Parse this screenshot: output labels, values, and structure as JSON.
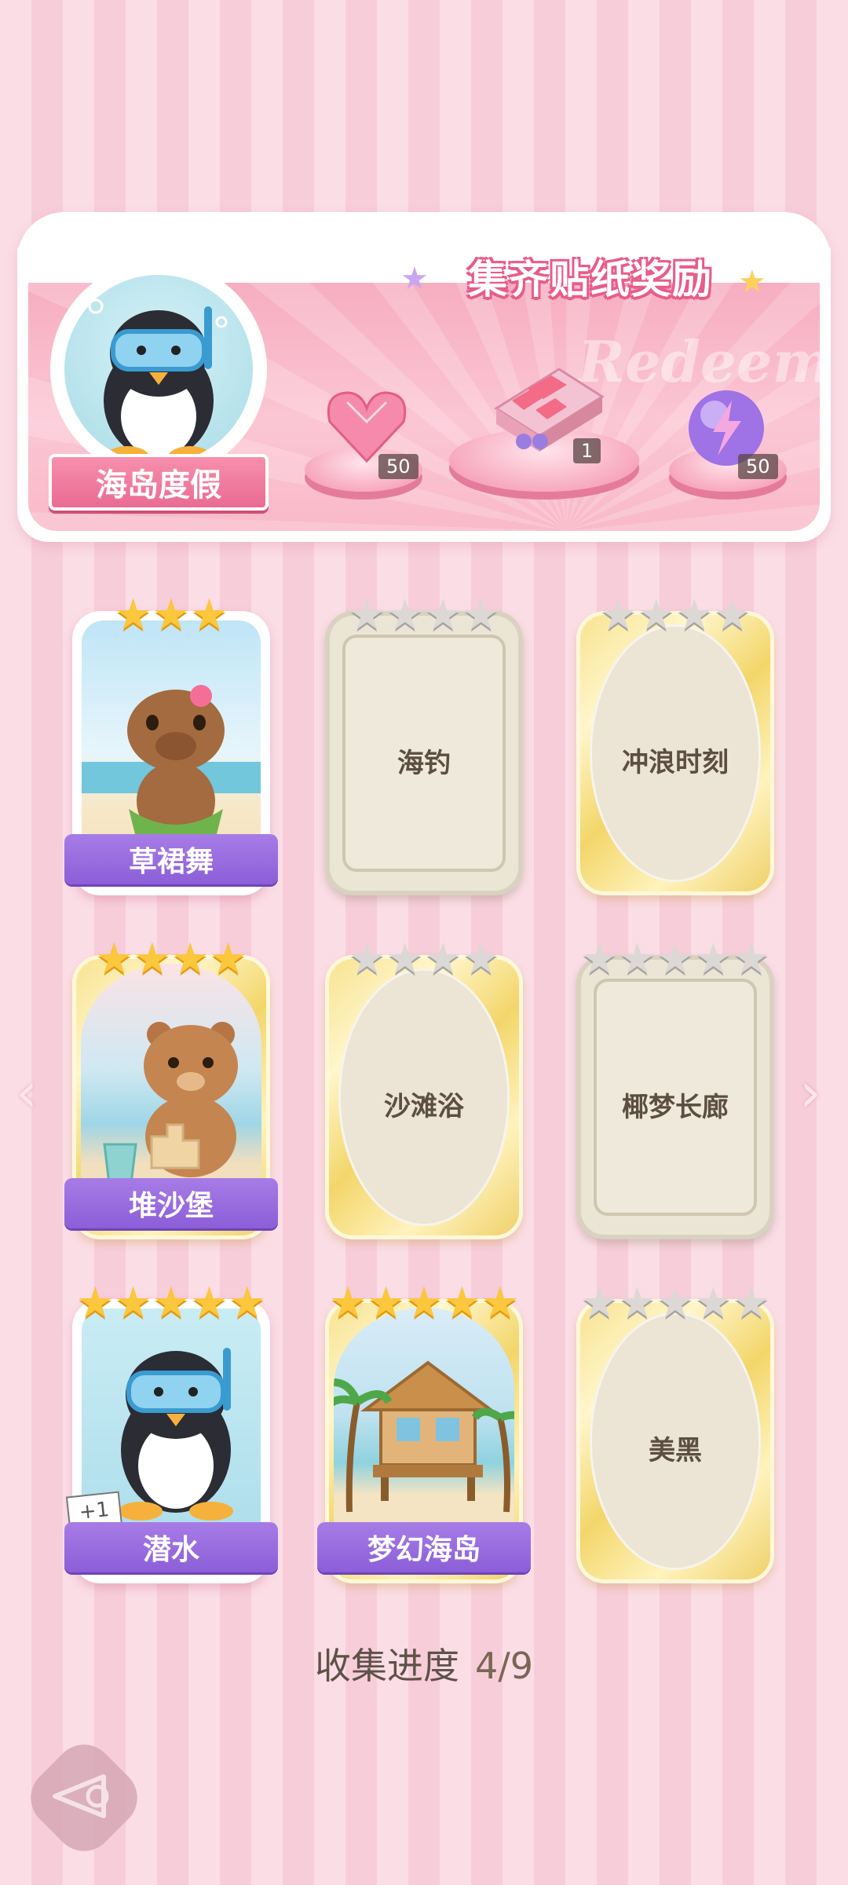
{
  "banner": {
    "title": "集齐贴纸奖励",
    "watermark": "Redeem",
    "theme_name": "海岛度假",
    "rewards": [
      {
        "icon": "pink-heart-gem-icon",
        "count": "50"
      },
      {
        "icon": "gift-box-icon",
        "count": "1"
      },
      {
        "icon": "lightning-orb-icon",
        "count": "50"
      }
    ]
  },
  "cards": [
    {
      "name": "草裙舞",
      "stars": 3,
      "collected": true,
      "frame": "white",
      "art": "capybara-hula-art"
    },
    {
      "name": "海钓",
      "stars": 4,
      "collected": false,
      "frame": "silver"
    },
    {
      "name": "冲浪时刻",
      "stars": 4,
      "collected": false,
      "frame": "gold"
    },
    {
      "name": "堆沙堡",
      "stars": 4,
      "collected": true,
      "frame": "gold",
      "art": "bear-sandcastle-art"
    },
    {
      "name": "沙滩浴",
      "stars": 4,
      "collected": false,
      "frame": "gold"
    },
    {
      "name": "椰梦长廊",
      "stars": 5,
      "collected": false,
      "frame": "silver"
    },
    {
      "name": "潜水",
      "stars": 5,
      "collected": true,
      "frame": "white",
      "art": "penguin-diving-art",
      "badge": "+1"
    },
    {
      "name": "梦幻海岛",
      "stars": 5,
      "collected": true,
      "frame": "gold",
      "art": "beach-hut-art"
    },
    {
      "name": "美黑",
      "stars": 5,
      "collected": false,
      "frame": "gold"
    }
  ],
  "progress": {
    "label": "收集进度",
    "value": "4/9"
  },
  "colors": {
    "accent_pink": "#e96b93",
    "label_purple": "#8c5ed8",
    "star_gold": "#fbc73c",
    "star_grey": "#dcd8d6"
  }
}
